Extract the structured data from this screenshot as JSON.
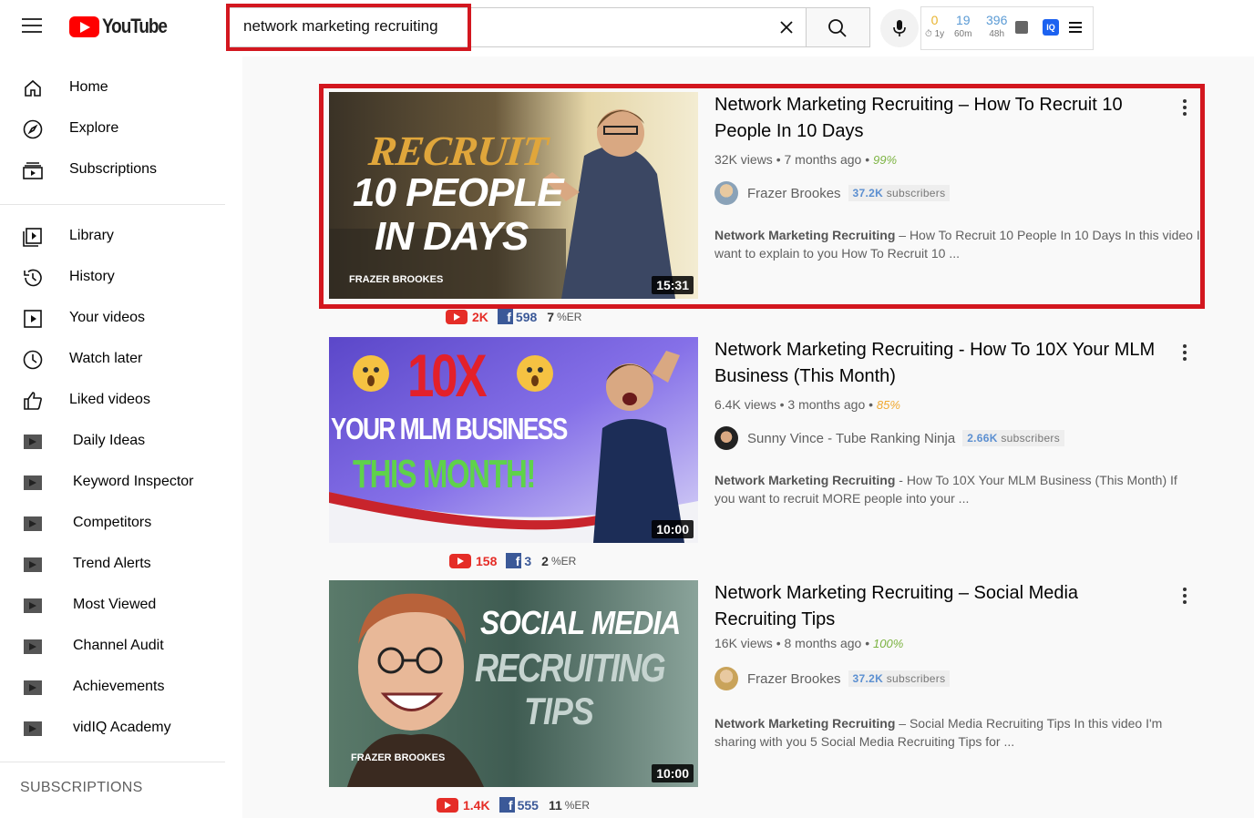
{
  "header": {
    "logo_text": "YouTube",
    "search_value": "network marketing recruiting",
    "vidiq_stats": [
      {
        "value": "0",
        "label": "⏱ 1y"
      },
      {
        "value": "19",
        "label": "60m"
      },
      {
        "value": "396",
        "label": "48h"
      }
    ],
    "vidiq_badge": "IQ"
  },
  "sidebar": {
    "primary": [
      {
        "label": "Home",
        "icon": "home-icon"
      },
      {
        "label": "Explore",
        "icon": "compass-icon"
      },
      {
        "label": "Subscriptions",
        "icon": "subscriptions-icon"
      }
    ],
    "library": [
      {
        "label": "Library",
        "icon": "library-icon"
      },
      {
        "label": "History",
        "icon": "history-icon"
      },
      {
        "label": "Your videos",
        "icon": "play-icon"
      },
      {
        "label": "Watch later",
        "icon": "clock-icon"
      },
      {
        "label": "Liked videos",
        "icon": "thumbs-up-icon"
      }
    ],
    "vidiq": [
      {
        "label": "Daily Ideas"
      },
      {
        "label": "Keyword Inspector"
      },
      {
        "label": "Competitors"
      },
      {
        "label": "Trend Alerts"
      },
      {
        "label": "Most Viewed"
      },
      {
        "label": "Channel Audit"
      },
      {
        "label": "Achievements"
      },
      {
        "label": "vidIQ Academy"
      }
    ],
    "subscriptions_title": "SUBSCRIPTIONS"
  },
  "results": [
    {
      "title": "Network Marketing Recruiting – How To Recruit 10 People In 10 Days",
      "views": "32K views",
      "age": "7 months ago",
      "score": "99%",
      "score_color": "#7cb342",
      "channel": "Frazer Brookes",
      "subs_count": "37.2K",
      "subs_label": "subscribers",
      "desc_bold": "Network Marketing Recruiting",
      "desc_rest": " – How To Recruit 10 People In 10 Days In this video I want to explain to you How To Recruit 10 ...",
      "duration": "15:31",
      "thumb_lines": [
        "RECRUIT",
        "10 PEOPLE",
        "IN DAYS"
      ],
      "thumb_brand": "FRAZER BROOKES",
      "yt_count": "2K",
      "fb_count": "598",
      "er_value": "7",
      "er_label": "%ER"
    },
    {
      "title": "Network Marketing Recruiting - How To 10X Your MLM Business (This Month)",
      "views": "6.4K views",
      "age": "3 months ago",
      "score": "85%",
      "score_color": "#f0a830",
      "channel": "Sunny Vince - Tube Ranking Ninja",
      "subs_count": "2.66K",
      "subs_label": "subscribers",
      "desc_bold": "Network Marketing Recruiting",
      "desc_rest": " - How To 10X Your MLM Business (This Month) If you want to recruit MORE people into your ...",
      "duration": "10:00",
      "thumb_lines": [
        "10X",
        "YOUR MLM BUSINESS",
        "THIS MONTH!"
      ],
      "thumb_brand": "",
      "yt_count": "158",
      "fb_count": "3",
      "er_value": "2",
      "er_label": "%ER"
    },
    {
      "title": "Network Marketing Recruiting – Social Media Recruiting Tips",
      "views": "16K views",
      "age": "8 months ago",
      "score": "100%",
      "score_color": "#7cb342",
      "channel": "Frazer Brookes",
      "subs_count": "37.2K",
      "subs_label": "subscribers",
      "desc_bold": "Network Marketing Recruiting",
      "desc_rest": " – Social Media Recruiting Tips In this video I'm sharing with you 5 Social Media Recruiting Tips for ...",
      "duration": "10:00",
      "thumb_lines": [
        "SOCIAL MEDIA",
        "RECRUITING",
        "TIPS"
      ],
      "thumb_brand": "FRAZER BROOKES",
      "yt_count": "1.4K",
      "fb_count": "555",
      "er_value": "11",
      "er_label": "%ER"
    }
  ]
}
